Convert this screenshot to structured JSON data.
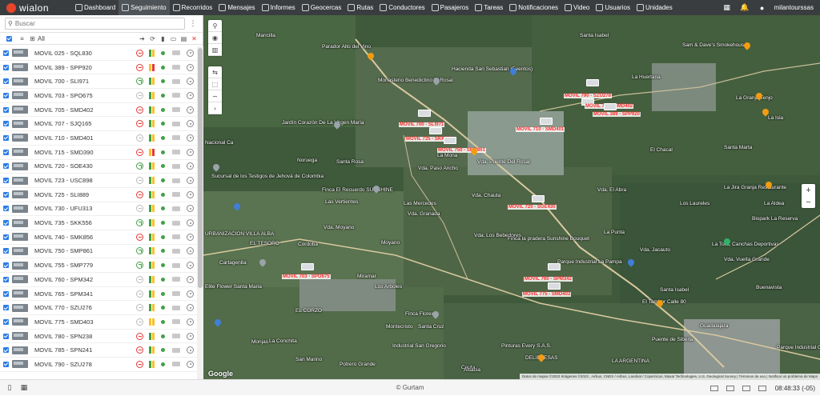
{
  "app": {
    "logo": "wialon"
  },
  "nav": [
    {
      "label": "Dashboard",
      "icon": "dashboard-icon"
    },
    {
      "label": "Seguimiento",
      "icon": "globe-icon",
      "active": true
    },
    {
      "label": "Recorridos",
      "icon": "route-icon"
    },
    {
      "label": "Mensajes",
      "icon": "messages-icon"
    },
    {
      "label": "Informes",
      "icon": "reports-icon"
    },
    {
      "label": "Geocercas",
      "icon": "geofence-icon"
    },
    {
      "label": "Rutas",
      "icon": "routes-icon"
    },
    {
      "label": "Conductores",
      "icon": "drivers-icon"
    },
    {
      "label": "Pasajeros",
      "icon": "passengers-icon"
    },
    {
      "label": "Tareas",
      "icon": "tasks-icon"
    },
    {
      "label": "Notificaciones",
      "icon": "notifications-icon"
    },
    {
      "label": "Video",
      "icon": "video-icon"
    },
    {
      "label": "Usuarios",
      "icon": "users-icon"
    },
    {
      "label": "Unidades",
      "icon": "units-icon"
    }
  ],
  "user": {
    "name": "milantourssas"
  },
  "search": {
    "placeholder": "Buscar"
  },
  "toolbar": {
    "all_label": "All"
  },
  "units": [
    {
      "name": "MOVIL 025 - SQL830",
      "status": "red",
      "battery": "full",
      "online": "green"
    },
    {
      "name": "MOVIL 389 - SPP920",
      "status": "red",
      "battery": "low",
      "online": "green"
    },
    {
      "name": "MOVIL 700 - SLI971",
      "status": "green",
      "battery": "full",
      "online": "green"
    },
    {
      "name": "MOVIL 703 - SPO675",
      "status": "grey",
      "battery": "full",
      "online": "green"
    },
    {
      "name": "MOVIL 705 - SMD402",
      "status": "red",
      "battery": "full",
      "online": "green"
    },
    {
      "name": "MOVIL 707 - SJQ165",
      "status": "red",
      "battery": "full",
      "online": "green"
    },
    {
      "name": "MOVIL 710 - SMD401",
      "status": "grey",
      "battery": "full",
      "online": "green"
    },
    {
      "name": "MOVIL 715 - SMD390",
      "status": "red",
      "battery": "low",
      "online": "green"
    },
    {
      "name": "MOVIL 720 - SOE430",
      "status": "green",
      "battery": "full",
      "online": "green"
    },
    {
      "name": "MOVIL 723 - USC898",
      "status": "grey",
      "battery": "full",
      "online": "green"
    },
    {
      "name": "MOVIL 725 - SLI889",
      "status": "red",
      "battery": "full",
      "online": "green"
    },
    {
      "name": "MOVIL 730 - UFU313",
      "status": "grey",
      "battery": "full",
      "online": "green"
    },
    {
      "name": "MOVIL 735 - SKK556",
      "status": "green",
      "battery": "full",
      "online": "green"
    },
    {
      "name": "MOVIL 740 - SMK856",
      "status": "red",
      "battery": "full",
      "online": "green"
    },
    {
      "name": "MOVIL 750 - SMP861",
      "status": "green",
      "battery": "full",
      "online": "green"
    },
    {
      "name": "MOVIL 755 - SMP779",
      "status": "green",
      "battery": "full",
      "online": "green"
    },
    {
      "name": "MOVIL 760 - SPM342",
      "status": "grey",
      "battery": "full",
      "online": "green"
    },
    {
      "name": "MOVIL 765 - SPM341",
      "status": "grey",
      "battery": "full",
      "online": "green"
    },
    {
      "name": "MOVIL 770 - SZU276",
      "status": "grey",
      "battery": "full",
      "online": "green"
    },
    {
      "name": "MOVIL 775 - SMD403",
      "status": "grey",
      "battery": "mid",
      "online": "green"
    },
    {
      "name": "MOVIL 780 - SPN238",
      "status": "red",
      "battery": "full",
      "online": "green"
    },
    {
      "name": "MOVIL 785 - SPN241",
      "status": "red",
      "battery": "full",
      "online": "green"
    },
    {
      "name": "MOVIL 790 - SZU278",
      "status": "red",
      "battery": "full",
      "online": "green"
    }
  ],
  "map": {
    "places": [
      "Mancilla",
      "Parador Alto del Vino",
      "Monasterio Benedictino El Rosal",
      "Hacienda San Sebastian (Eventos)",
      "Santa Isabel",
      "Sam & Dave's Smokehouse",
      "La Huertana",
      "La Granja Tenjo",
      "La Isla",
      "Jardín Corazón De La Virgen María",
      "El Chacal",
      "Santa Marta",
      "Noruega",
      "Santa Rosa",
      "Vda. Paso Ancho",
      "Vda. Puente Del Rosal",
      "La Mona",
      "Sucursal de los Testigos de Jehová de Colombia",
      "Finca El Recuerdo SUNSHINE",
      "Las Vertientes",
      "Las Mercedes",
      "Vda. Chauta",
      "Vda. El Abra",
      "Los Laureles",
      "La Jira Granja Restaurante",
      "La Aldea",
      "Biopark La Reserva",
      "Vda. Granada",
      "Vda. Moyano",
      "Moyano",
      "Vda. Los Bebedores",
      "Finca la pradera Sunshine Bouquet",
      "La Punta",
      "EL TESORO",
      "Cordoba",
      "Parque Industrial La Pampa",
      "Vda. Jacauto",
      "La Tora, Canchas Deportivas",
      "Vda. Vuelta Grande",
      "Cartagenita",
      "Miramar",
      "Elite Flower Santa Maria",
      "Los Arboles",
      "Buenavista",
      "El Tambor Calle 80",
      "Santa Isabel",
      "EL CORZO",
      "Finca Florex",
      "Montecristo",
      "Santa Cruz",
      "Guadalajara",
      "La Conchita",
      "Industrial San Gregorio",
      "Pinturas Every S.A.S.",
      "Puente de Siberia",
      "Monjas",
      "San Marino",
      "Potrero Grande",
      "DELIFRESAS",
      "Ceuta",
      "Alsacia",
      "LA ARGENTINA",
      "Parque Industrial Gran Sabana",
      "URBANIZACION VILLA ALBA",
      "Nacional Ca"
    ],
    "unit_labels": [
      "MOVIL 790 - SZU278",
      "MOVIL 705 - SMD402",
      "MOVIL 389 - SPP920",
      "MOVIL 700 - SLI971",
      "MOVIL 735 - SKK556",
      "MOVIL 750 - SMP861",
      "MOVIL 710 - SMD401",
      "MOVIL 720 - SOE430",
      "MOVIL 760 - SPM342",
      "MOVIL 775 - SMD403",
      "MOVIL 703 - SPO675"
    ],
    "attribution": "Datos de mapas ©2023 Imágenes ©2023 , Airbus, CNES / Airbus, Landsat / Copernicus, Maxar Technologies, U.S. Geological Survey | Términos de uso | Notificar un problema de Maps",
    "google": "Google"
  },
  "footer": {
    "copyright": "© Gurtam",
    "clock": "08:48:33 (-05)"
  },
  "colors": {
    "topbar": "#3a3d40",
    "accent": "#2b7de9",
    "alert": "#e53935",
    "ok": "#43a047"
  }
}
